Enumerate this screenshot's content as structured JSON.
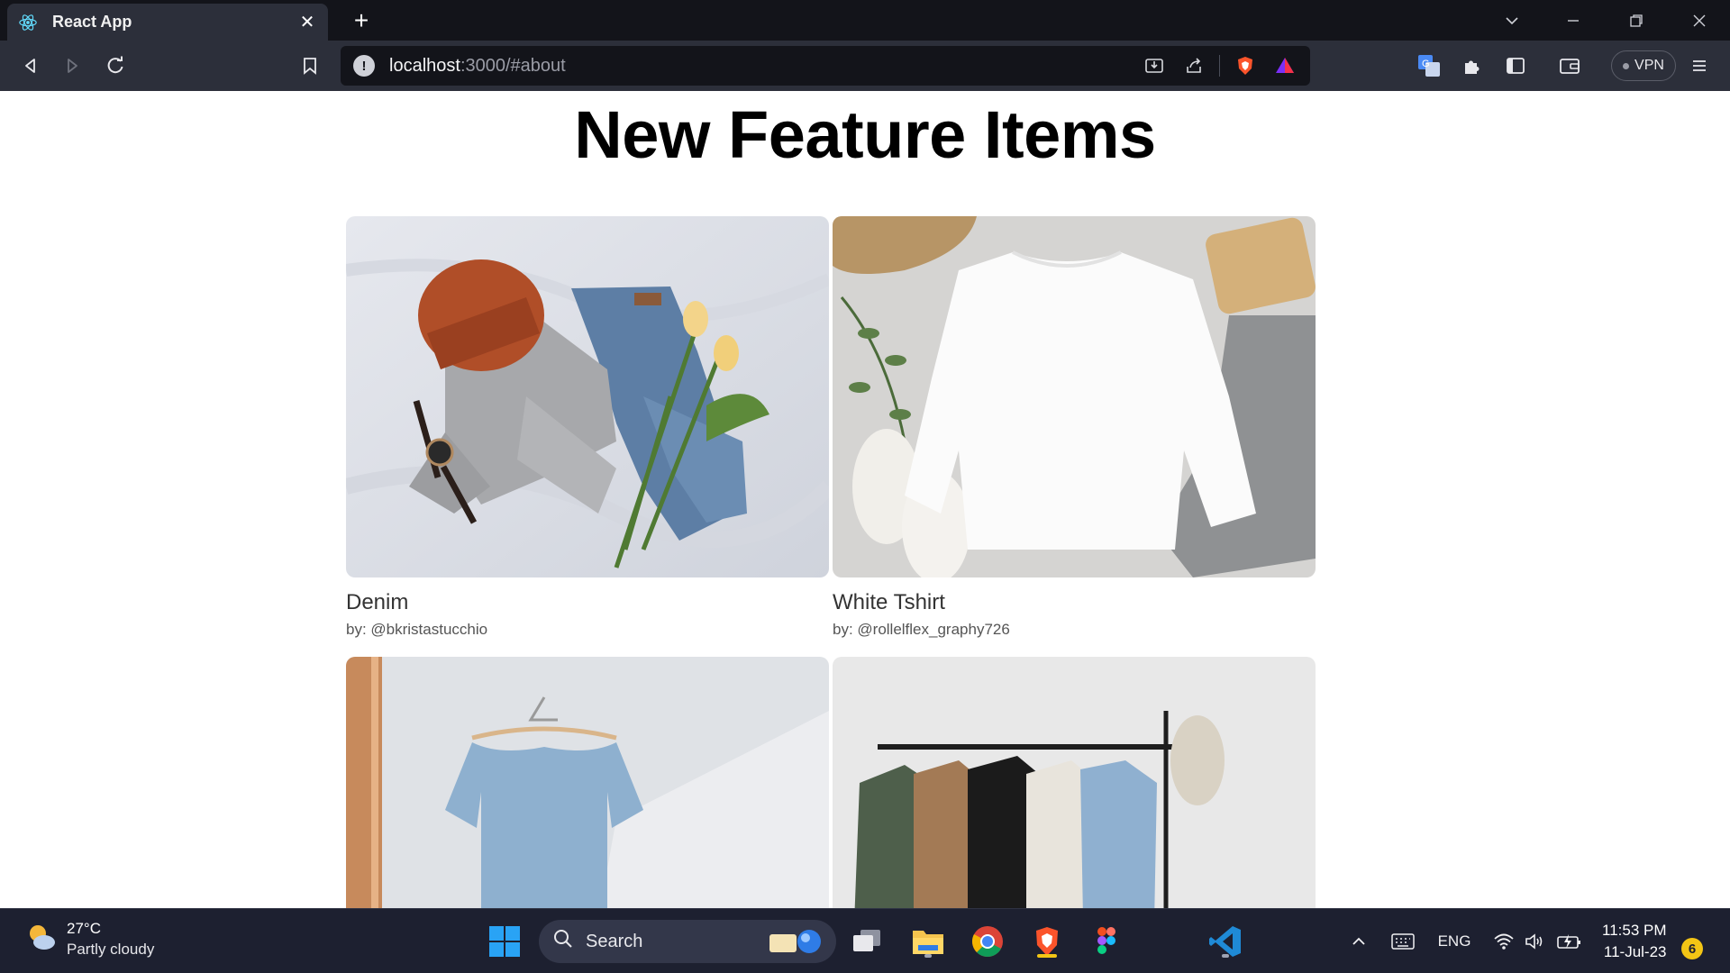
{
  "browser": {
    "tab_title": "React App",
    "tab_close": "✕",
    "new_tab": "+",
    "url_host": "localhost",
    "url_rest": ":3000/#about",
    "vpn_label": "VPN"
  },
  "page": {
    "title": "New Feature Items",
    "items": [
      {
        "name": "Denim",
        "author": "by: @bkristastucchio"
      },
      {
        "name": "White Tshirt",
        "author": "by: @rollelflex_graphy726"
      },
      {
        "name": "",
        "author": ""
      },
      {
        "name": "",
        "author": ""
      }
    ]
  },
  "taskbar": {
    "weather_temp": "27°C",
    "weather_desc": "Partly cloudy",
    "search_label": "Search",
    "language": "ENG",
    "time": "11:53 PM",
    "date": "11-Jul-23",
    "notification_count": "6"
  },
  "colors": {
    "tabbar_bg": "#13141a",
    "toolbar_bg": "#2c2f3a",
    "taskbar_bg": "#1d2030",
    "brave_orange": "#fb542b"
  }
}
